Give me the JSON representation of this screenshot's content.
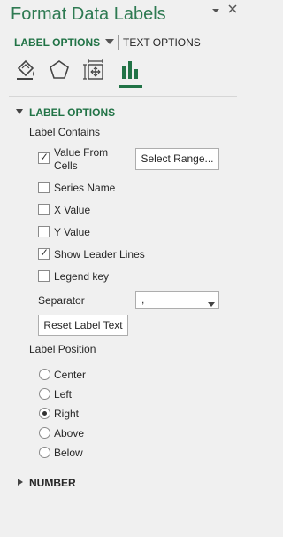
{
  "pane": {
    "title": "Format Data Labels",
    "menu_arrow_icon": "chevron-down-icon",
    "close_icon": "close-icon"
  },
  "tabs": {
    "active": "LABEL OPTIONS",
    "inactive": "TEXT OPTIONS"
  },
  "category_icons": [
    "fill-line-icon",
    "effects-pentagon-icon",
    "size-properties-icon",
    "label-options-bar-chart-icon"
  ],
  "label_options": {
    "header": "LABEL OPTIONS",
    "contains_heading": "Label Contains",
    "value_from_cells_line1": "Value From",
    "value_from_cells_line2": "Cells",
    "select_range": "Select Range...",
    "checkboxes": [
      {
        "label": "Series Name",
        "checked": false
      },
      {
        "label": "X Value",
        "checked": false
      },
      {
        "label": "Y Value",
        "checked": false
      },
      {
        "label": "Show Leader Lines",
        "checked": true
      },
      {
        "label": "Legend key",
        "checked": false
      }
    ],
    "value_from_cells_checked": true,
    "separator_label": "Separator",
    "separator_value": ",",
    "reset_button": "Reset Label Text",
    "position_heading": "Label Position",
    "positions": [
      {
        "label": "Center",
        "selected": false
      },
      {
        "label": "Left",
        "selected": false
      },
      {
        "label": "Right",
        "selected": true
      },
      {
        "label": "Above",
        "selected": false
      },
      {
        "label": "Below",
        "selected": false
      }
    ]
  },
  "number_section": {
    "header": "NUMBER"
  },
  "colors": {
    "accent": "#217346",
    "title": "#2e7a52",
    "background": "#f0f0f0"
  }
}
